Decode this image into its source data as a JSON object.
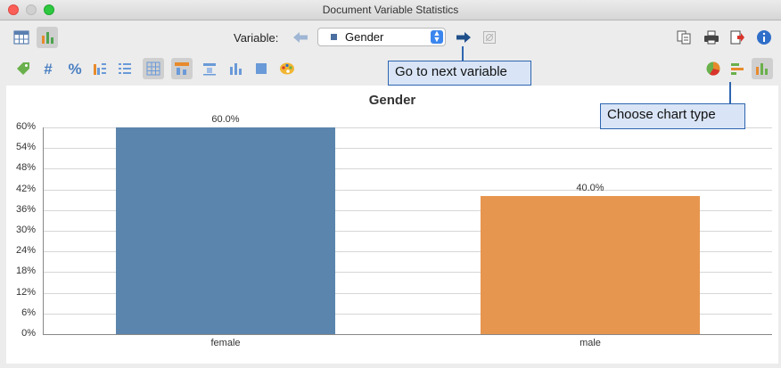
{
  "window": {
    "title": "Document Variable Statistics"
  },
  "toolbar": {
    "variable_label": "Variable:",
    "selected_variable": "Gender"
  },
  "callouts": {
    "next_variable": "Go to next variable",
    "chart_type": "Choose chart type"
  },
  "colors": {
    "female": "#5b85ad",
    "male": "#e7964f",
    "callout_bg": "#d9e5f6",
    "callout_border": "#2e65b0"
  },
  "chart_data": {
    "type": "bar",
    "title": "Gender",
    "categories": [
      "female",
      "male"
    ],
    "values": [
      60.0,
      40.0
    ],
    "value_labels": [
      "60.0%",
      "40.0%"
    ],
    "ylim": [
      0,
      60
    ],
    "yticks": [
      "0%",
      "6%",
      "12%",
      "18%",
      "24%",
      "30%",
      "36%",
      "42%",
      "48%",
      "54%",
      "60%"
    ],
    "grid": true,
    "legend": "none"
  }
}
